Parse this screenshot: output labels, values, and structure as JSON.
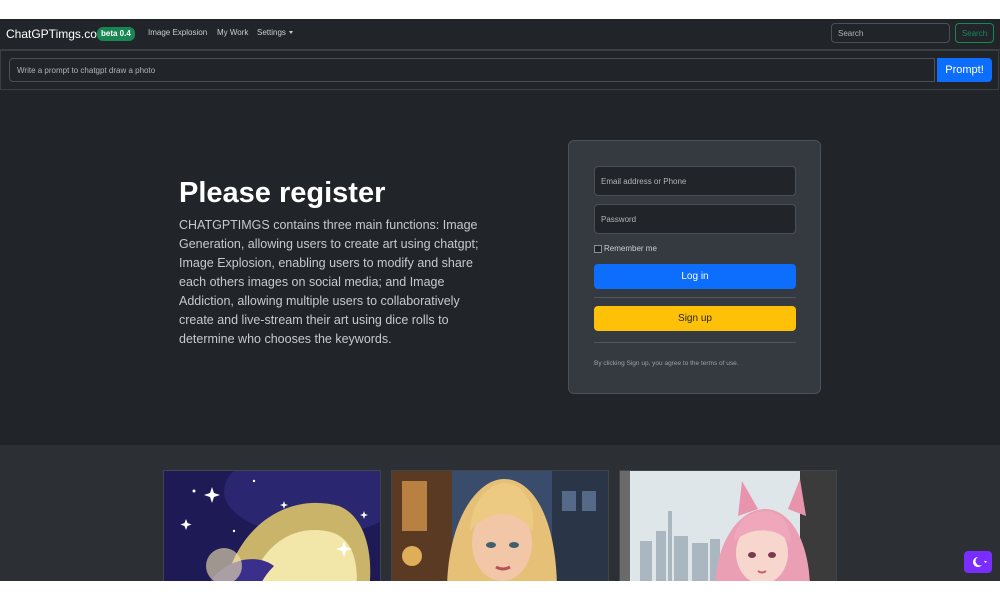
{
  "navbar": {
    "brand": "ChatGPTimgs.com",
    "badge": "beta 0.4",
    "links": [
      "Image Explosion",
      "My Work",
      "Settings"
    ],
    "search_placeholder": "Search",
    "search_button": "Search"
  },
  "prompt": {
    "placeholder": "Write a prompt to chatgpt draw a photo",
    "button": "Prompt!"
  },
  "hero": {
    "title": "Please register",
    "description": "CHATGPTIMGS contains three main functions: Image Generation, allowing users to create art using chatgpt; Image Explosion, enabling users to modify and share each others images on social media; and Image Addiction, allowing multiple users to collaboratively create and live-stream their art using dice rolls to determine who chooses the keywords."
  },
  "form": {
    "email_placeholder": "Email address or Phone",
    "password_placeholder": "Password",
    "remember_label": "Remember me",
    "login_button": "Log in",
    "signup_button": "Sign up",
    "terms_text": "By clicking Sign up, you agree to the terms of use."
  },
  "colors": {
    "background": "#212529",
    "primary": "#0d6efd",
    "success": "#198754",
    "warning": "#ffc107",
    "toggle": "#7a2dff"
  },
  "icons": {
    "theme_toggle": "moon-icon"
  }
}
